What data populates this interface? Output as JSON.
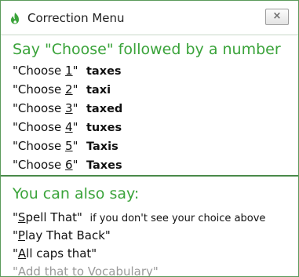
{
  "window": {
    "title": "Correction Menu",
    "close_label": "×",
    "accent_color": "#3aa33a",
    "icon": "dragon-flame-icon"
  },
  "choose_section": {
    "heading": "Say \"Choose\" followed by a number",
    "choices": [
      {
        "prefix": "\"Choose ",
        "number": "1",
        "suffix": "\"",
        "word": "taxes"
      },
      {
        "prefix": "\"Choose ",
        "number": "2",
        "suffix": "\"",
        "word": "taxi"
      },
      {
        "prefix": "\"Choose ",
        "number": "3",
        "suffix": "\"",
        "word": "taxed"
      },
      {
        "prefix": "\"Choose ",
        "number": "4",
        "suffix": "\"",
        "word": "tuxes"
      },
      {
        "prefix": "\"Choose ",
        "number": "5",
        "suffix": "\"",
        "word": "Taxis"
      },
      {
        "prefix": "\"Choose ",
        "number": "6",
        "suffix": "\"",
        "word": "Taxes"
      }
    ]
  },
  "also_section": {
    "heading": "You can also say:",
    "commands": [
      {
        "quote_open": "\"",
        "key": "S",
        "rest": "pell That\"",
        "note": "if you don't see your choice above",
        "enabled": true
      },
      {
        "quote_open": "\"",
        "key": "P",
        "rest": "lay That Back\"",
        "note": "",
        "enabled": true
      },
      {
        "quote_open": "\"",
        "key": "A",
        "rest": "ll caps that\"",
        "note": "",
        "enabled": true
      },
      {
        "quote_open": "\"Add that to ",
        "key": "V",
        "rest": "ocabulary\"",
        "note": "",
        "enabled": false
      }
    ]
  }
}
